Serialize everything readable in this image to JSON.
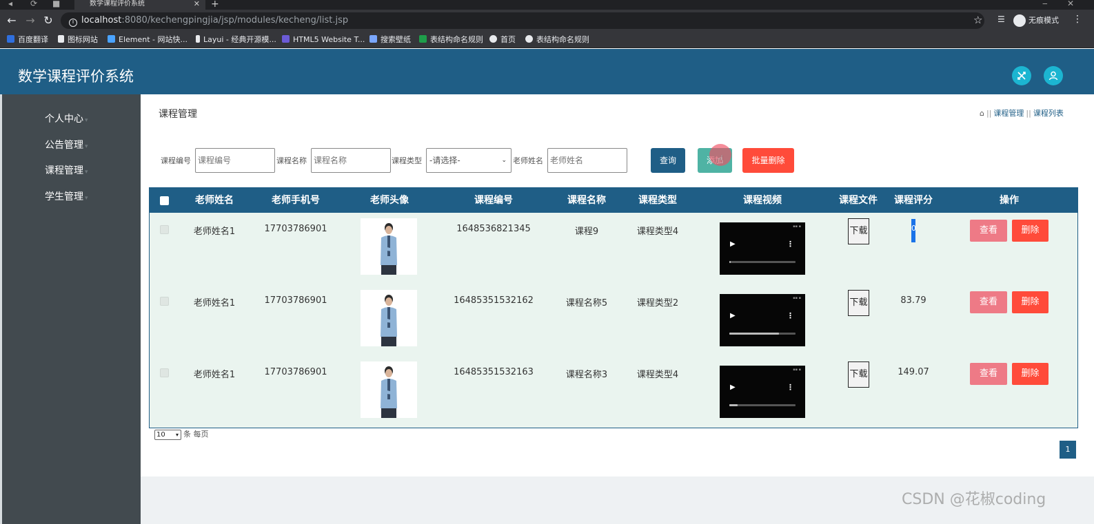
{
  "browser": {
    "tab_title": "数学课程评价系统",
    "url_host": "localhost",
    "url_path": ":8080/kechengpingjia/jsp/modules/kecheng/list.jsp",
    "incognito_label": "无痕模式",
    "bookmarks": [
      {
        "label": "百度翻译",
        "color": "#2f6fde"
      },
      {
        "label": "图标网站",
        "color": "#e8eaed"
      },
      {
        "label": "Element - 网站快...",
        "color": "#4aa3ff"
      },
      {
        "label": "Layui - 经典开源模...",
        "color": "#e8eaed"
      },
      {
        "label": "HTML5 Website T...",
        "color": "#6b5bd6"
      },
      {
        "label": "搜索壁纸",
        "color": "#7aa7ff"
      },
      {
        "label": "表结构命名规则",
        "color": "#1e9e4a"
      },
      {
        "label": "首页",
        "color": "#e8eaed"
      },
      {
        "label": "表结构命名规则",
        "color": "#e8eaed"
      }
    ]
  },
  "app": {
    "title": "数学课程评价系统",
    "header_icons": [
      "shuffle-icon",
      "user-icon"
    ]
  },
  "sidebar": {
    "items": [
      {
        "label": "个人中心"
      },
      {
        "label": "公告管理"
      },
      {
        "label": "课程管理"
      },
      {
        "label": "学生管理"
      }
    ]
  },
  "page": {
    "title": "课程管理",
    "breadcrumb": [
      "课程管理",
      "课程列表"
    ]
  },
  "search": {
    "course_no_label": "课程编号",
    "course_no_placeholder": "课程编号",
    "course_name_label": "课程名称",
    "course_name_placeholder": "课程名称",
    "course_type_label": "课程类型",
    "course_type_selected": "-请选择-",
    "teacher_name_label": "老师姓名",
    "teacher_name_placeholder": "老师姓名",
    "query_btn": "查询",
    "add_btn": "添加",
    "batch_delete_btn": "批量删除"
  },
  "table": {
    "columns": [
      "老师姓名",
      "老师手机号",
      "老师头像",
      "课程编号",
      "课程名称",
      "课程类型",
      "课程视频",
      "课程文件",
      "课程评分",
      "操作"
    ],
    "rows": [
      {
        "teacher_name": "老师姓名1",
        "phone": "17703786901",
        "course_no": "1648536821345",
        "course_name": "课程9",
        "course_type": "课程类型4",
        "file_btn": "下载",
        "score": "0",
        "video_progress": 0.02
      },
      {
        "teacher_name": "老师姓名1",
        "phone": "17703786901",
        "course_no": "16485351532162",
        "course_name": "课程名称5",
        "course_type": "课程类型2",
        "file_btn": "下载",
        "score": "83.79",
        "video_progress": 0.75
      },
      {
        "teacher_name": "老师姓名1",
        "phone": "17703786901",
        "course_no": "16485351532163",
        "course_name": "课程名称3",
        "course_type": "课程类型4",
        "file_btn": "下载",
        "score": "149.07",
        "video_progress": 0.12
      }
    ],
    "view_btn": "查看",
    "delete_btn": "删除"
  },
  "pagination": {
    "page_size": "10",
    "page_size_suffix": "条 每页",
    "current_page": "1"
  },
  "watermark": "CSDN @花椒coding",
  "colors": {
    "primary": "#1f5e86",
    "danger": "#ff4b3a",
    "view": "#ee7a86",
    "add": "#4fb3a4",
    "sidebar": "#424a4f",
    "header_icon": "#1cb5d1"
  }
}
